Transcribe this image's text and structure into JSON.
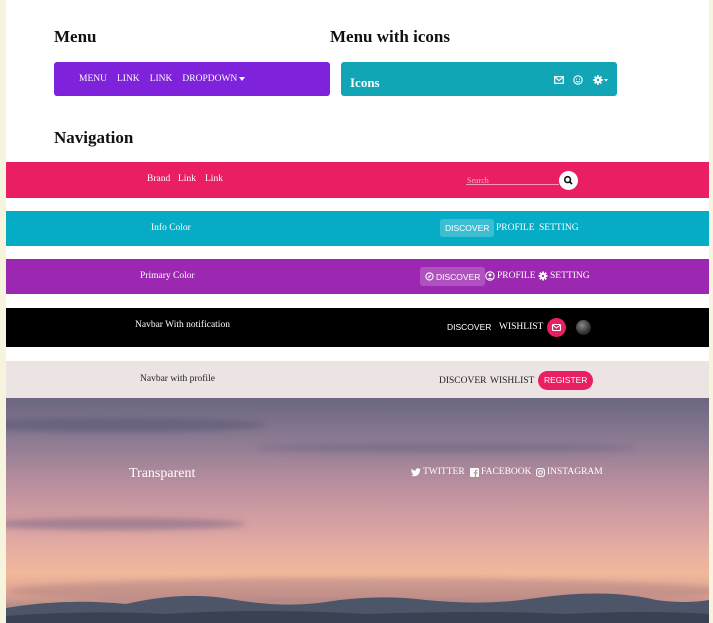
{
  "sections": {
    "menu": "Menu",
    "menu_icons": "Menu with icons",
    "navigation": "Navigation"
  },
  "menu": {
    "items": [
      "MENU",
      "LINK",
      "LINK",
      "DROPDOWN"
    ]
  },
  "menu_icons": {
    "label": "Icons",
    "icons": [
      "mail-icon",
      "smile-icon",
      "gear-icon"
    ]
  },
  "nav1": {
    "brand": "Brand",
    "links": [
      "Link",
      "Link"
    ],
    "search_placeholder": "Search",
    "color": "#e91e63"
  },
  "nav2": {
    "brand": "Info Color",
    "items": [
      "DISCOVER",
      "PROFILE",
      "SETTING"
    ],
    "color": "#06acc6"
  },
  "nav3": {
    "brand": "Primary Color",
    "items": [
      "DISCOVER",
      "PROFILE",
      "SETTING"
    ],
    "color": "#9c27b0"
  },
  "nav4": {
    "brand": "Navbar With notification",
    "items": [
      "DISCOVER",
      "WISHLIST"
    ],
    "color": "#000000"
  },
  "nav5": {
    "brand": "Navbar with profile",
    "items": [
      "DISCOVER",
      "WISHLIST"
    ],
    "register": "REGISTER",
    "color": "#ebe4e3"
  },
  "hero": {
    "brand": "Transparent",
    "social": [
      "TWITTER",
      "FACEBOOK",
      "INSTAGRAM"
    ]
  }
}
